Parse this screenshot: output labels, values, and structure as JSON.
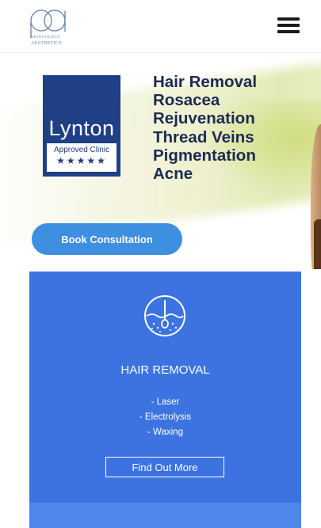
{
  "header": {
    "logo_subtitle": "SKINCOLOGY",
    "logo_brand": "AESTHETICS",
    "menu_icon": "hamburger-menu-icon"
  },
  "hero": {
    "badge": {
      "brand": "Lynton",
      "approved": "Approved Clinic",
      "stars": "★★★★★",
      "rating_stars": 5
    },
    "treatments": [
      "Hair Removal",
      "Rosacea",
      "Rejuvenation",
      "Thread Veins",
      "Pigmentation",
      "Acne"
    ],
    "cta_label": "Book Consultation"
  },
  "service_card": {
    "icon": "hair-follicle-icon",
    "title": "HAIR REMOVAL",
    "items": [
      "- Laser",
      "- Electrolysis",
      "- Waxing"
    ],
    "cta_label": "Find Out More"
  },
  "colors": {
    "card_blue": "#3d73e0",
    "button_blue": "#3f8fe0",
    "badge_navy": "#1f3f86",
    "heading_navy": "#1b2a52"
  }
}
